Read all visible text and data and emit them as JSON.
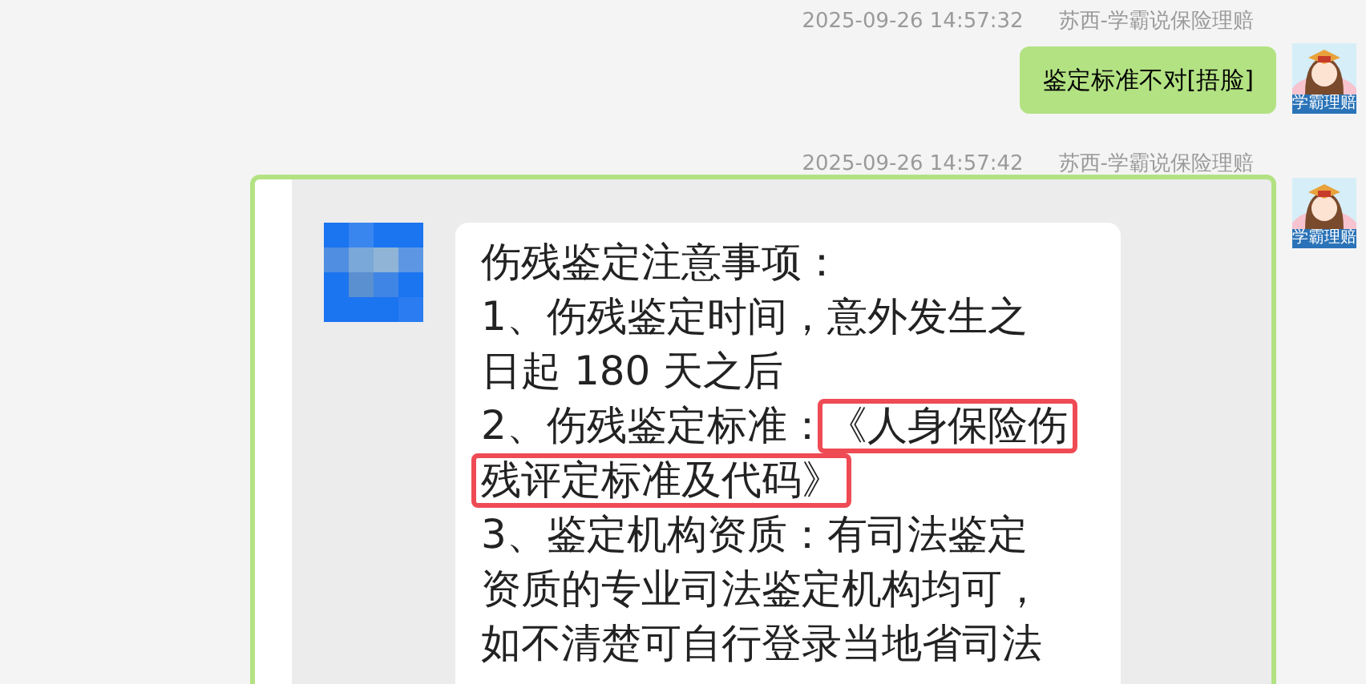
{
  "messages": [
    {
      "kind": "text",
      "time": "2025-09-26 14:57:32",
      "sender": "苏西-学霸说保险理赔",
      "avatar_label": "学霸理赔",
      "text": "鉴定标准不对[捂脸]"
    },
    {
      "time": "2025-09-26 14:57:42",
      "sender": "苏西-学霸说保险理赔",
      "avatar_label": "学霸理赔",
      "image": {
        "lines": [
          [
            {
              "text": "伤残鉴定注意事项：",
              "highlighted": false
            }
          ],
          [
            {
              "text": "1、伤残鉴定时间，意外发生之",
              "highlighted": false
            }
          ],
          [
            {
              "text": "日起 180 天之后",
              "highlighted": false
            }
          ],
          [
            {
              "text": "2、伤残鉴定标准：",
              "highlighted": false
            },
            {
              "text": "《人身保险伤",
              "highlighted": true
            }
          ],
          [
            {
              "text": "残评定标准及代码》",
              "highlighted": true
            }
          ],
          [
            {
              "text": "3、鉴定机构资质：有司法鉴定",
              "highlighted": false
            }
          ],
          [
            {
              "text": "资质的专业司法鉴定机构均可，",
              "highlighted": false
            }
          ],
          [
            {
              "text": "如不清楚可自行登录当地省司法",
              "highlighted": false
            }
          ]
        ]
      }
    }
  ]
}
